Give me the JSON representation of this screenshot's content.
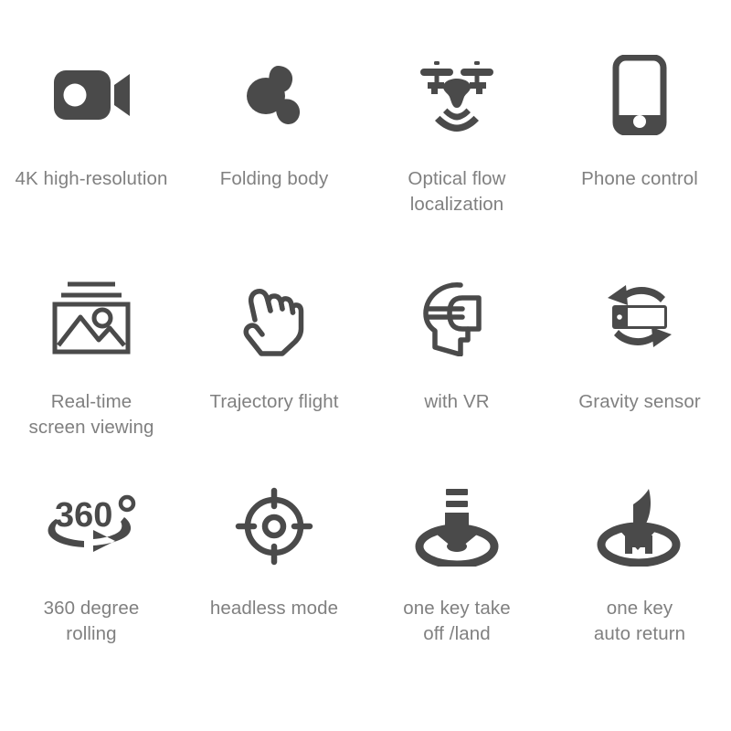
{
  "theme": {
    "background": "#ffffff",
    "icon_color": "#4a4a4a",
    "text_color": "#808080"
  },
  "grid": {
    "columns": 4,
    "rows": 3
  },
  "features": [
    {
      "icon": "video-camera-icon",
      "label": "4K high-resolution"
    },
    {
      "icon": "folding-propeller-icon",
      "label": "Folding body"
    },
    {
      "icon": "drone-signal-icon",
      "label": "Optical flow\nlocalization"
    },
    {
      "icon": "smartphone-icon",
      "label": "Phone control"
    },
    {
      "icon": "photo-gallery-icon",
      "label": "Real-time\nscreen viewing"
    },
    {
      "icon": "pointing-hand-icon",
      "label": "Trajectory flight"
    },
    {
      "icon": "vr-headset-head-icon",
      "label": "with VR"
    },
    {
      "icon": "tablet-rotate-icon",
      "label": "Gravity sensor"
    },
    {
      "icon": "360-rotation-icon",
      "label": "360 degree\nrolling"
    },
    {
      "icon": "crosshair-target-icon",
      "label": "headless mode"
    },
    {
      "icon": "arrow-down-landing-pad-icon",
      "label": "one key take\noff /land"
    },
    {
      "icon": "curved-arrow-helipad-icon",
      "label": "one key\nauto return"
    }
  ]
}
